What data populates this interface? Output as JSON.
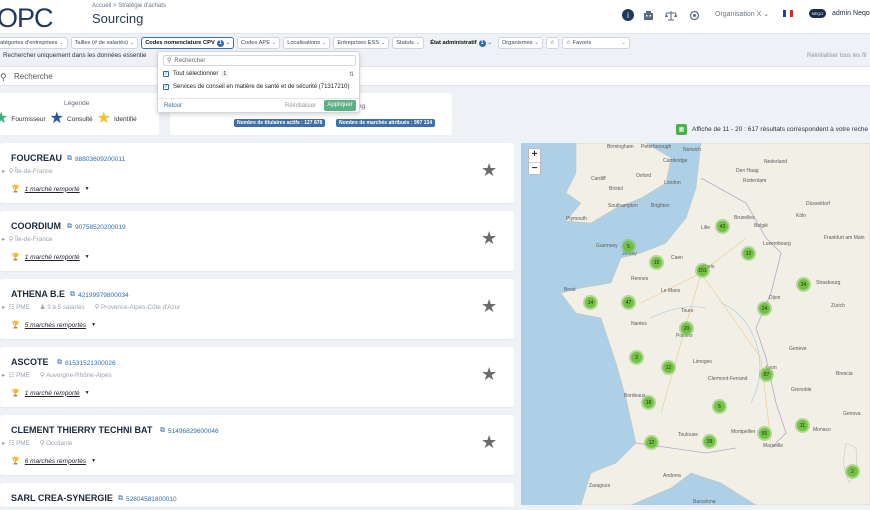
{
  "header": {
    "logo": "OPC",
    "breadcrumb_home": "Accueil",
    "breadcrumb_sep": " > ",
    "breadcrumb_current": "Stratégie d'achats",
    "page_title": "Sourcing",
    "org_selector": "Organisation X",
    "user_name": "admin Neqo",
    "avatar_text": "NEQO"
  },
  "filters": [
    {
      "label": "atégories d'entreprises",
      "active": false,
      "bold": false,
      "badge": null
    },
    {
      "label": "Tailles (# de salariés)",
      "active": false,
      "bold": false,
      "badge": null
    },
    {
      "label": "Codes nomenclature CPV",
      "active": true,
      "bold": true,
      "badge": "1"
    },
    {
      "label": "Codes APE",
      "active": false,
      "bold": false,
      "badge": null
    },
    {
      "label": "Localisations",
      "active": false,
      "bold": false,
      "badge": null
    },
    {
      "label": "Entreprises ESS",
      "active": false,
      "bold": false,
      "badge": null
    },
    {
      "label": "Statuts",
      "active": false,
      "bold": false,
      "badge": null
    },
    {
      "label": "État administratif",
      "active": false,
      "bold": true,
      "badge": "1"
    },
    {
      "label": "Organismes",
      "active": false,
      "bold": false,
      "badge": null
    }
  ],
  "favorites_filter": "Favoris",
  "search_in_data": "Rechercher uniquement dans les données essentie",
  "reset_all": "Réinitialiser tous les fil",
  "search_placeholder": "Recherche",
  "legend": {
    "title": "Légende",
    "items": [
      {
        "label": "Fournisseur",
        "color": "#3fae7a"
      },
      {
        "label": "Consulté",
        "color": "#2a55a5"
      },
      {
        "label": "Identifié",
        "color": "#f2c12e"
      }
    ]
  },
  "stats": {
    "label": "ng",
    "titulaires": "Nombre de titulaires actifs : 127 878",
    "marches": "Nombre de marchés attribués : 997 134"
  },
  "results_info": "Affiche de 11 - 20 : 617 résultats correspondent à votre reche",
  "cpv_dropdown": {
    "search_placeholder": "Rechercher",
    "select_all": "Tout sélectionner",
    "select_all_count": "1",
    "option": "Services de conseil en matière de santé et de sécurité (71317210)",
    "back": "Retour",
    "reset": "Réinitialiser",
    "apply": "Appliquer"
  },
  "companies": [
    {
      "name": "FOUCREAU",
      "siret": "88803609200011",
      "category": "",
      "size": "",
      "region": "Île-de-France",
      "markets": "1 marché remporté"
    },
    {
      "name": "COORDIUM",
      "siret": "90758520200019",
      "category": "",
      "size": "",
      "region": "Île-de-France",
      "markets": "1 marché remporté"
    },
    {
      "name": "ATHENA B.E",
      "siret": "42199979800034",
      "category": "PME",
      "size": "3 à 5 salariés",
      "region": "Provence-Alpes-Côte d'Azur",
      "markets": "5 marchés remportés"
    },
    {
      "name": "ASCOTE",
      "siret": "81531521300026",
      "category": "PME",
      "size": "",
      "region": "Auvergne-Rhône-Alpes",
      "markets": "1 marché remporté"
    },
    {
      "name": "CLEMENT THIERRY TECHNI BAT",
      "siret": "51496829600046",
      "category": "PME",
      "size": "",
      "region": "Occitanie",
      "markets": "6 marchés remportés"
    },
    {
      "name": "SARL CREA-SYNERGIE",
      "siret": "52804581800010",
      "category": "",
      "size": "",
      "region": "",
      "markets": ""
    }
  ],
  "map": {
    "clusters": [
      "43",
      "5",
      "15",
      "151",
      "12",
      "34",
      "14",
      "47",
      "24",
      "20",
      "3",
      "12",
      "87",
      "5",
      "18",
      "12",
      "39",
      "65",
      "11",
      "2"
    ],
    "places": [
      "Birmingham",
      "Peterborough",
      "Norwich",
      "Cambridge",
      "Oxford",
      "London",
      "Cardiff",
      "Bristol",
      "Southampton",
      "Brighton",
      "Plymouth",
      "Nederland",
      "Den Haag",
      "Rotterdam",
      "Düsseldorf",
      "Köln",
      "Bruxelles",
      "België",
      "Lille",
      "Luxembourg",
      "Frankfurt am Main",
      "Paris",
      "Rennes",
      "Le Mans",
      "Tours",
      "Nantes",
      "Dijon",
      "Zürich",
      "Poitiers",
      "Limoges",
      "Lyon",
      "Genève",
      "Bordeaux",
      "Grenoble",
      "Toulouse",
      "Montpellier",
      "Marseille",
      "Monaco",
      "Genova",
      "Zaragoza",
      "Andorra",
      "Barcelona",
      "Guernsey",
      "Jersey",
      "Caen",
      "Brest",
      "Strasbourg",
      "Clermont-Ferrand",
      "Brescia"
    ]
  },
  "colors": {
    "primary": "#2b6cb0",
    "apply_button": "#5cb085",
    "cluster": "#78c450",
    "sea": "#aed0e6",
    "land": "#f2efe6"
  }
}
